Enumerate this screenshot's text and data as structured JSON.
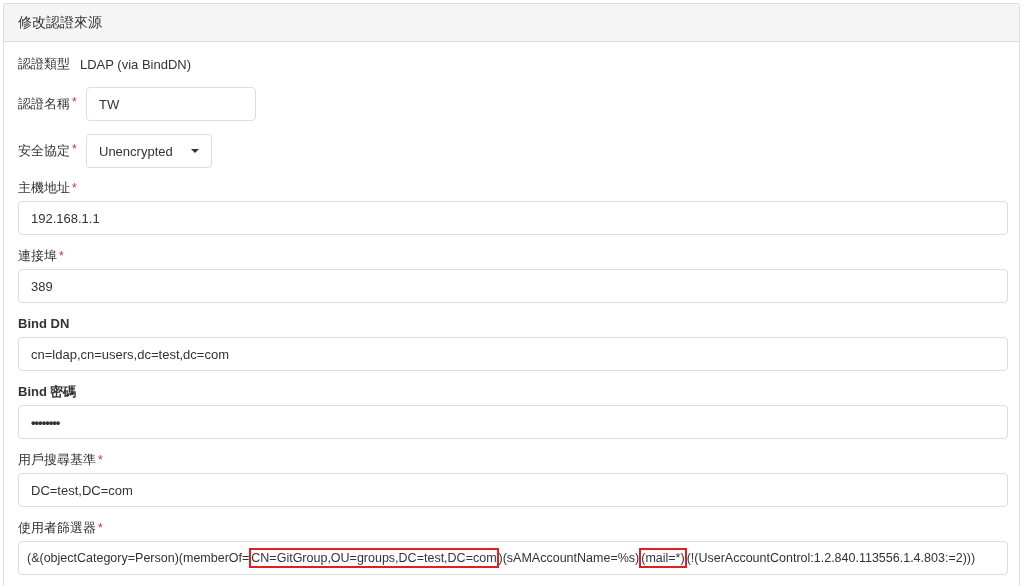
{
  "panel": {
    "title": "修改認證來源"
  },
  "inline_fields": [
    {
      "kind": "static",
      "label": "認證類型",
      "bold": false,
      "value": "LDAP (via BindDN)"
    },
    {
      "kind": "text",
      "label": "認證名稱",
      "required_mark": "*",
      "bold": false,
      "value": "TW"
    },
    {
      "kind": "select",
      "label": "安全協定",
      "required_mark": "*",
      "bold": false,
      "value": "Unencrypted"
    }
  ],
  "stacked_fields": [
    {
      "kind": "text",
      "label": "主機地址",
      "required_mark": "*",
      "bold": false,
      "value": "192.168.1.1"
    },
    {
      "kind": "text",
      "label": "連接埠",
      "required_mark": "*",
      "bold": false,
      "value": "389"
    },
    {
      "kind": "text",
      "label": "Bind DN",
      "bold": true,
      "value": "cn=ldap,cn=users,dc=test,dc=com"
    },
    {
      "kind": "password",
      "label": "Bind 密碼",
      "bold": true,
      "value": "••••••••"
    },
    {
      "kind": "text",
      "label": "用戶搜尋基準",
      "required_mark": "*",
      "bold": false,
      "value": "DC=test,DC=com"
    },
    {
      "kind": "segmented",
      "label": "使用者篩選器",
      "required_mark": "*",
      "bold": false,
      "segments": [
        {
          "text": "(&(objectCategory=Person)(memberOf=",
          "highlighted": false
        },
        {
          "text": "CN=GitGroup,OU=groups,DC=test,DC=com",
          "highlighted": true
        },
        {
          "text": ")(sAMAccountName=%s)",
          "highlighted": false
        },
        {
          "text": "(mail=*)",
          "highlighted": true
        },
        {
          "text": "(!(UserAccountControl:1.2.840.113556.1.4.803:=2)))",
          "highlighted": false
        }
      ]
    }
  ]
}
